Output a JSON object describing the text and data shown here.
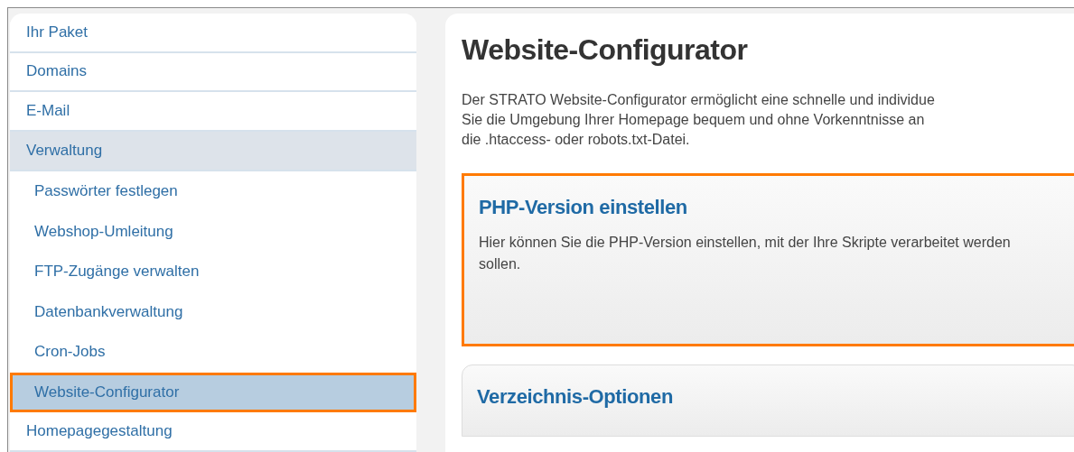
{
  "sidebar": {
    "items": [
      {
        "label": "Ihr Paket",
        "selected": false
      },
      {
        "label": "Domains",
        "selected": false
      },
      {
        "label": "E-Mail",
        "selected": false
      },
      {
        "label": "Verwaltung",
        "selected": true,
        "children": [
          {
            "label": "Passwörter festlegen",
            "selected": false,
            "highlighted": false
          },
          {
            "label": "Webshop-Umleitung",
            "selected": false,
            "highlighted": false
          },
          {
            "label": "FTP-Zugänge verwalten",
            "selected": false,
            "highlighted": false
          },
          {
            "label": "Datenbankverwaltung",
            "selected": false,
            "highlighted": false
          },
          {
            "label": "Cron-Jobs",
            "selected": false,
            "highlighted": false
          },
          {
            "label": "Website-Configurator",
            "selected": true,
            "highlighted": true
          }
        ]
      },
      {
        "label": "Homepagegestaltung",
        "selected": false
      }
    ]
  },
  "main": {
    "title": "Website-Configurator",
    "intro_lines": [
      "Der STRATO Website-Configurator ermöglicht eine schnelle und individue",
      "Sie die Umgebung Ihrer Homepage bequem und ohne Vorkenntnisse an",
      "die .htaccess- oder robots.txt-Datei."
    ],
    "cards": [
      {
        "title": "PHP-Version einstellen",
        "text": "Hier können Sie die PHP-Version einstellen, mit der Ihre Skripte verarbeitet werden sollen.",
        "highlighted": true
      },
      {
        "title": "Verzeichnis-Optionen",
        "highlighted": false
      }
    ]
  }
}
